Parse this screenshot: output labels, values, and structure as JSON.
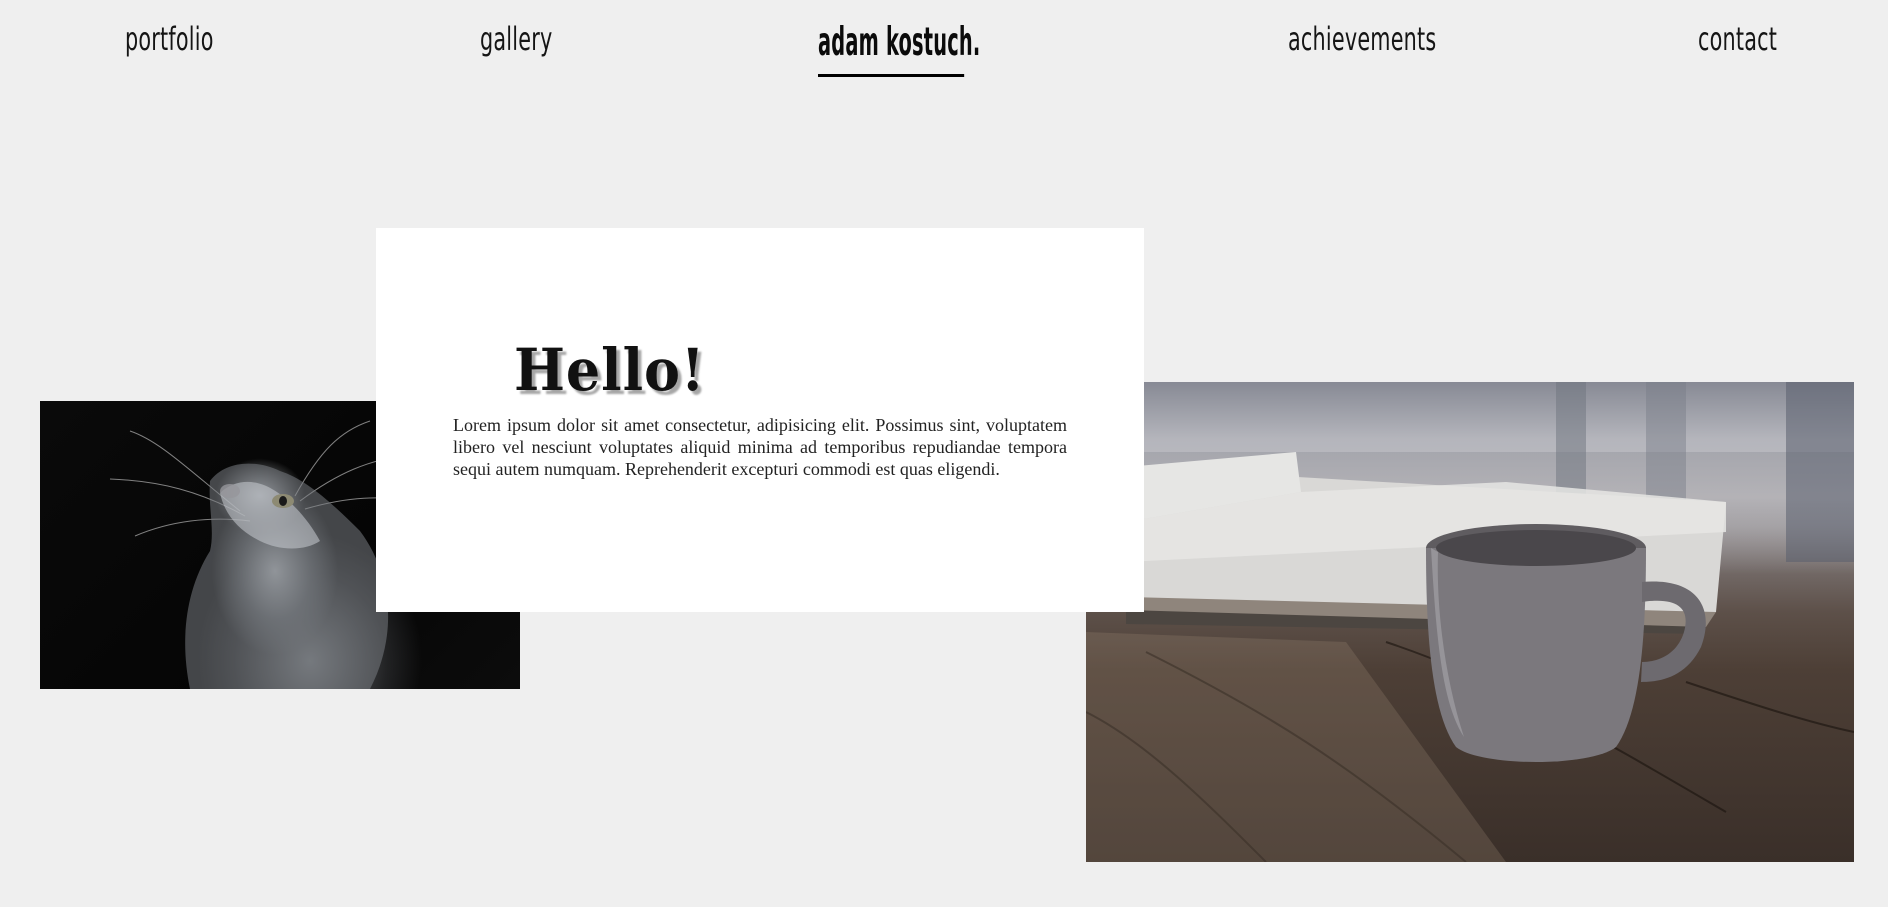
{
  "nav": {
    "portfolio": "portfolio",
    "gallery": "gallery",
    "brand": "adam kostuch.",
    "achievements": "achievements",
    "contact": "contact"
  },
  "hero": {
    "heading": "Hello!",
    "body": "Lorem ipsum dolor sit amet consectetur, adipisicing elit. Possimus sint, voluptatem libero vel nesciunt voluptates aliquid minima ad temporibus repudiandae tempora sequi autem numquam. Reprehenderit excepturi commodi est quas eligendi."
  },
  "images": {
    "left": "cat-photo",
    "right": "coffee-mug-photo"
  },
  "colors": {
    "background": "#efefef",
    "card": "#ffffff",
    "text": "#111111"
  }
}
